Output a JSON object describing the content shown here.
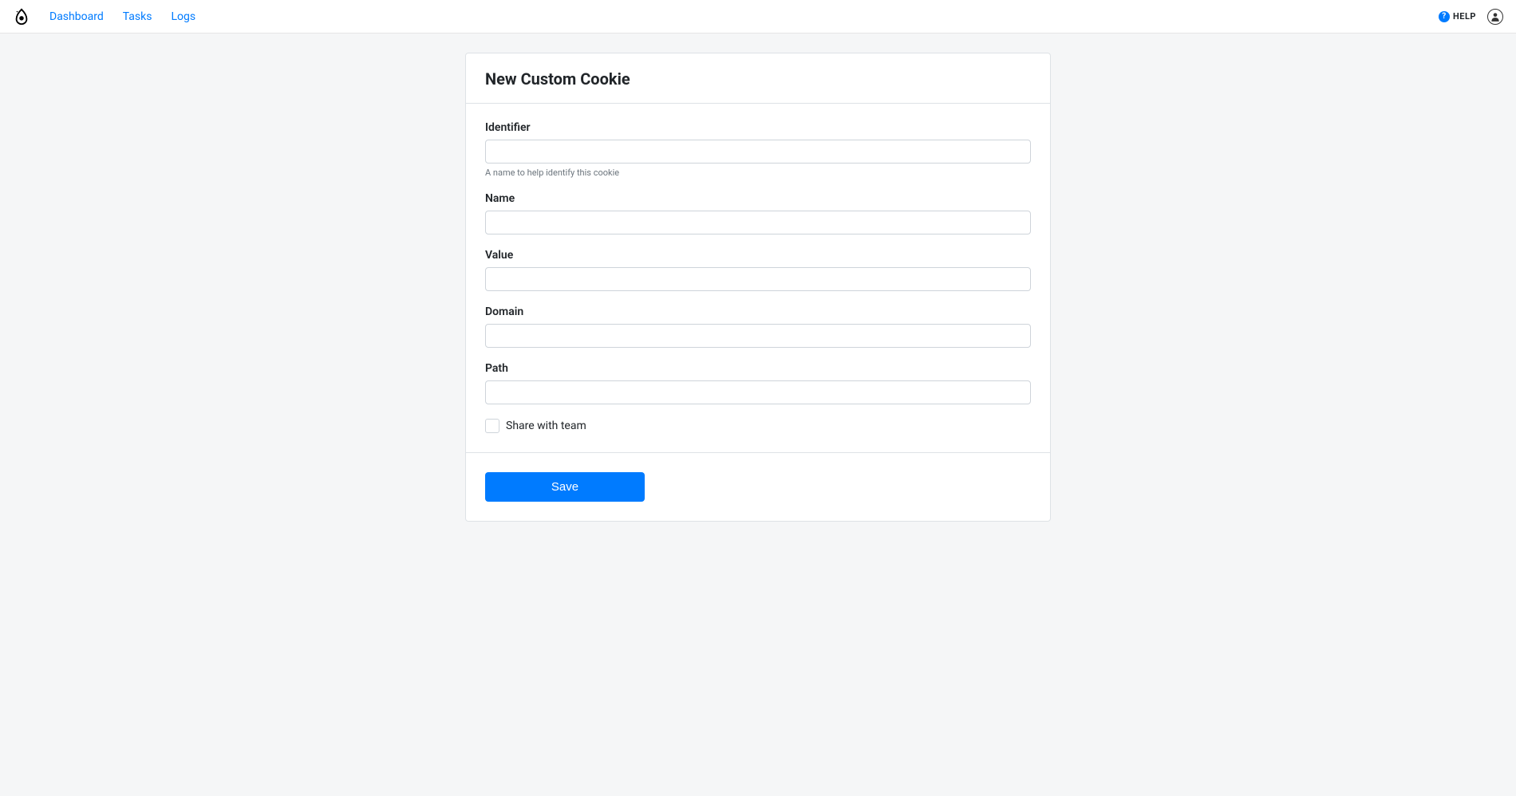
{
  "nav": {
    "dashboard": "Dashboard",
    "tasks": "Tasks",
    "logs": "Logs",
    "help": "HELP"
  },
  "page": {
    "title": "New Custom Cookie"
  },
  "form": {
    "identifier": {
      "label": "Identifier",
      "value": "",
      "hint": "A name to help identify this cookie"
    },
    "name": {
      "label": "Name",
      "value": ""
    },
    "value": {
      "label": "Value",
      "value": ""
    },
    "domain": {
      "label": "Domain",
      "value": ""
    },
    "path": {
      "label": "Path",
      "value": ""
    },
    "share": {
      "label": "Share with team",
      "checked": false
    }
  },
  "actions": {
    "save": "Save"
  }
}
